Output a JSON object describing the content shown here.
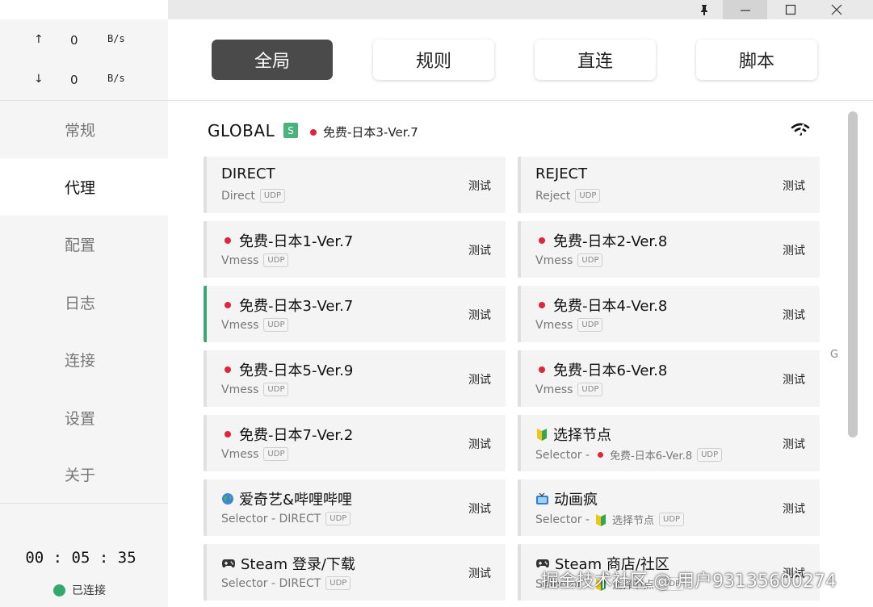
{
  "window": {
    "pin_icon": "pin-icon",
    "min_icon": "minimize-icon",
    "max_icon": "maximize-icon",
    "close_icon": "close-icon"
  },
  "traffic": {
    "up_arrow": "↑",
    "up_value": "0",
    "up_unit": "B/s",
    "down_arrow": "↓",
    "down_value": "0",
    "down_unit": "B/s"
  },
  "sidebar": {
    "items": [
      {
        "label": "常规"
      },
      {
        "label": "代理"
      },
      {
        "label": "配置"
      },
      {
        "label": "日志"
      },
      {
        "label": "连接"
      },
      {
        "label": "设置"
      },
      {
        "label": "关于"
      }
    ],
    "active": "代理",
    "timer": "00 : 05 : 35",
    "status": "已连接",
    "status_color": "#36a86b"
  },
  "modes": {
    "items": [
      {
        "label": "全局"
      },
      {
        "label": "规则"
      },
      {
        "label": "直连"
      },
      {
        "label": "脚本"
      }
    ],
    "active": "全局"
  },
  "group": {
    "title": "GLOBAL",
    "badge": "S",
    "current": "免费-日本3-Ver.7"
  },
  "proxies": [
    {
      "name": "DIRECT",
      "type": "Direct",
      "udp": "UDP",
      "test": "测试",
      "icon": ""
    },
    {
      "name": "REJECT",
      "type": "Reject",
      "udp": "UDP",
      "test": "测试",
      "icon": ""
    },
    {
      "name": "免费-日本1-Ver.7",
      "type": "Vmess",
      "udp": "UDP",
      "test": "测试",
      "icon": "jp-flag"
    },
    {
      "name": "免费-日本2-Ver.8",
      "type": "Vmess",
      "udp": "UDP",
      "test": "测试",
      "icon": "jp-flag"
    },
    {
      "name": "免费-日本3-Ver.7",
      "type": "Vmess",
      "udp": "UDP",
      "test": "测试",
      "icon": "jp-flag",
      "selected": true
    },
    {
      "name": "免费-日本4-Ver.8",
      "type": "Vmess",
      "udp": "UDP",
      "test": "测试",
      "icon": "jp-flag"
    },
    {
      "name": "免费-日本5-Ver.9",
      "type": "Vmess",
      "udp": "UDP",
      "test": "测试",
      "icon": "jp-flag"
    },
    {
      "name": "免费-日本6-Ver.8",
      "type": "Vmess",
      "udp": "UDP",
      "test": "测试",
      "icon": "jp-flag"
    },
    {
      "name": "免费-日本7-Ver.2",
      "type": "Vmess",
      "udp": "UDP",
      "test": "测试",
      "icon": "jp-flag"
    },
    {
      "name": "选择节点",
      "type": "Selector -",
      "now": "免费-日本6-Ver.8",
      "udp": "UDP",
      "test": "测试",
      "icon": "beginner-icon"
    },
    {
      "name": "爱奇艺&哔哩哔哩",
      "type": "Selector - DIRECT",
      "udp": "UDP",
      "test": "测试",
      "icon": "globe-icon"
    },
    {
      "name": "动画疯",
      "type": "Selector -",
      "now": "选择节点",
      "udp": "UDP",
      "test": "测试",
      "icon": "tv-icon"
    },
    {
      "name": "Steam 登录/下载",
      "type": "Selector - DIRECT",
      "udp": "UDP",
      "test": "测试",
      "icon": "gamepad-icon"
    },
    {
      "name": "Steam 商店/社区",
      "type": "Selector -",
      "now": "选择节点",
      "udp": "UDP",
      "test": "测试",
      "icon": "gamepad-icon"
    }
  ],
  "side_letter": "G",
  "watermark": "掘金技术社区 @ 用户9313560​0274"
}
